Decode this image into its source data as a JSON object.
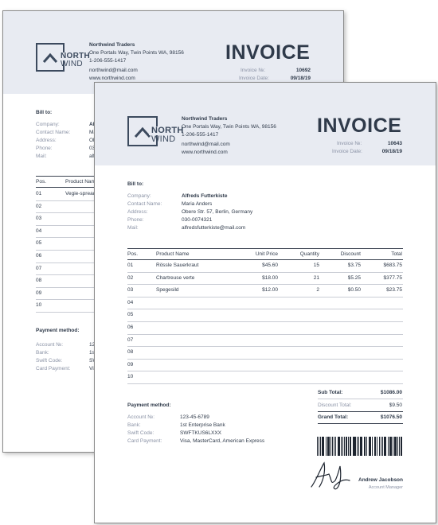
{
  "back": {
    "company": {
      "name": "Northwind Traders",
      "address": "One Portals Way, Twin Points WA, 98156",
      "phone": "1-206-555-1417",
      "email": "northwind@mail.com",
      "website": "www.northwind.com"
    },
    "logo": {
      "line1": "NORTH",
      "line2": "WIND"
    },
    "title": "INVOICE",
    "invoice_no_label": "Invoice №:",
    "invoice_no": "10692",
    "invoice_date_label": "Invoice Date:",
    "invoice_date": "09/18/19",
    "bill_to": "Bill to:",
    "bill_labels": [
      "Company:",
      "Contact Name:",
      "Address:",
      "Phone:",
      "Mail:"
    ],
    "bill_values": [
      "Al",
      "Ma",
      "Ob",
      "030",
      "alfr"
    ],
    "table_headers": [
      "Pos.",
      "Product Nam"
    ],
    "rows": [
      {
        "pos": "01",
        "product": "Vegie-spread"
      },
      {
        "pos": "02",
        "product": ""
      },
      {
        "pos": "03",
        "product": ""
      },
      {
        "pos": "04",
        "product": ""
      },
      {
        "pos": "05",
        "product": ""
      },
      {
        "pos": "06",
        "product": ""
      },
      {
        "pos": "07",
        "product": ""
      },
      {
        "pos": "08",
        "product": ""
      },
      {
        "pos": "09",
        "product": ""
      },
      {
        "pos": "10",
        "product": ""
      }
    ],
    "payment_title": "Payment method:",
    "payment_labels": [
      "Account №:",
      "Bank:",
      "Swift Code:",
      "Card Payment:"
    ],
    "payment_values": [
      "123",
      "1st",
      "SW",
      "Vis"
    ]
  },
  "front": {
    "company": {
      "name": "Northwind Traders",
      "address": "One Portals Way, Twin Points WA, 98156",
      "phone": "1-206-555-1417",
      "email": "northwind@mail.com",
      "website": "www.northwind.com"
    },
    "logo": {
      "line1": "NORTH",
      "line2": "WIND"
    },
    "title": "INVOICE",
    "invoice_no_label": "Invoice №:",
    "invoice_no": "10643",
    "invoice_date_label": "Invoice Date:",
    "invoice_date": "09/18/19",
    "bill_to": "Bill to:",
    "bill_labels": [
      "Company:",
      "Contact Name:",
      "Address:",
      "Phone:",
      "Mail:"
    ],
    "bill_values": [
      "Alfreds Futterkiste",
      "Maria Anders",
      "Obere Str. 57, Berlin, Germany",
      "030-0074321",
      "alfredsfutterkiste@mail.com"
    ],
    "table_headers": [
      "Pos.",
      "Product Name",
      "Unit Price",
      "Quantity",
      "Discount",
      "Total"
    ],
    "rows": [
      {
        "pos": "01",
        "product": "Rössle Sauerkraut",
        "unit_price": "$45.60",
        "quantity": "15",
        "discount": "$3.75",
        "total": "$683.75"
      },
      {
        "pos": "02",
        "product": "Chartreuse verte",
        "unit_price": "$18.00",
        "quantity": "21",
        "discount": "$5.25",
        "total": "$377.75"
      },
      {
        "pos": "03",
        "product": "Spegesild",
        "unit_price": "$12.00",
        "quantity": "2",
        "discount": "$0.50",
        "total": "$23.75"
      },
      {
        "pos": "04",
        "product": "",
        "unit_price": "",
        "quantity": "",
        "discount": "",
        "total": ""
      },
      {
        "pos": "05",
        "product": "",
        "unit_price": "",
        "quantity": "",
        "discount": "",
        "total": ""
      },
      {
        "pos": "06",
        "product": "",
        "unit_price": "",
        "quantity": "",
        "discount": "",
        "total": ""
      },
      {
        "pos": "07",
        "product": "",
        "unit_price": "",
        "quantity": "",
        "discount": "",
        "total": ""
      },
      {
        "pos": "08",
        "product": "",
        "unit_price": "",
        "quantity": "",
        "discount": "",
        "total": ""
      },
      {
        "pos": "09",
        "product": "",
        "unit_price": "",
        "quantity": "",
        "discount": "",
        "total": ""
      },
      {
        "pos": "10",
        "product": "",
        "unit_price": "",
        "quantity": "",
        "discount": "",
        "total": ""
      }
    ],
    "totals": {
      "subtotal_label": "Sub Total:",
      "subtotal": "$1086.00",
      "discount_label": "Discount Total:",
      "discount": "$9.50",
      "grand_label": "Grand Total:",
      "grand": "$1076.50"
    },
    "payment_title": "Payment method:",
    "payment_labels": [
      "Account №:",
      "Bank:",
      "Swift Code:",
      "Card Payment:"
    ],
    "payment_values": [
      "123-45-6789",
      "1st Enterprise Bank",
      "SWFTKUS6LXXX",
      "Visa, MasterCard, American Express"
    ],
    "signer": {
      "name": "Andrew Jacobson",
      "title": "Account Manager"
    }
  },
  "colors": {
    "band": "#e8ebf2",
    "text": "#2f3a4a",
    "label": "#8b93a6",
    "logo": "#3c4a5e"
  },
  "icons": [
    "northwind-logo-icon",
    "barcode-icon",
    "signature-icon"
  ]
}
